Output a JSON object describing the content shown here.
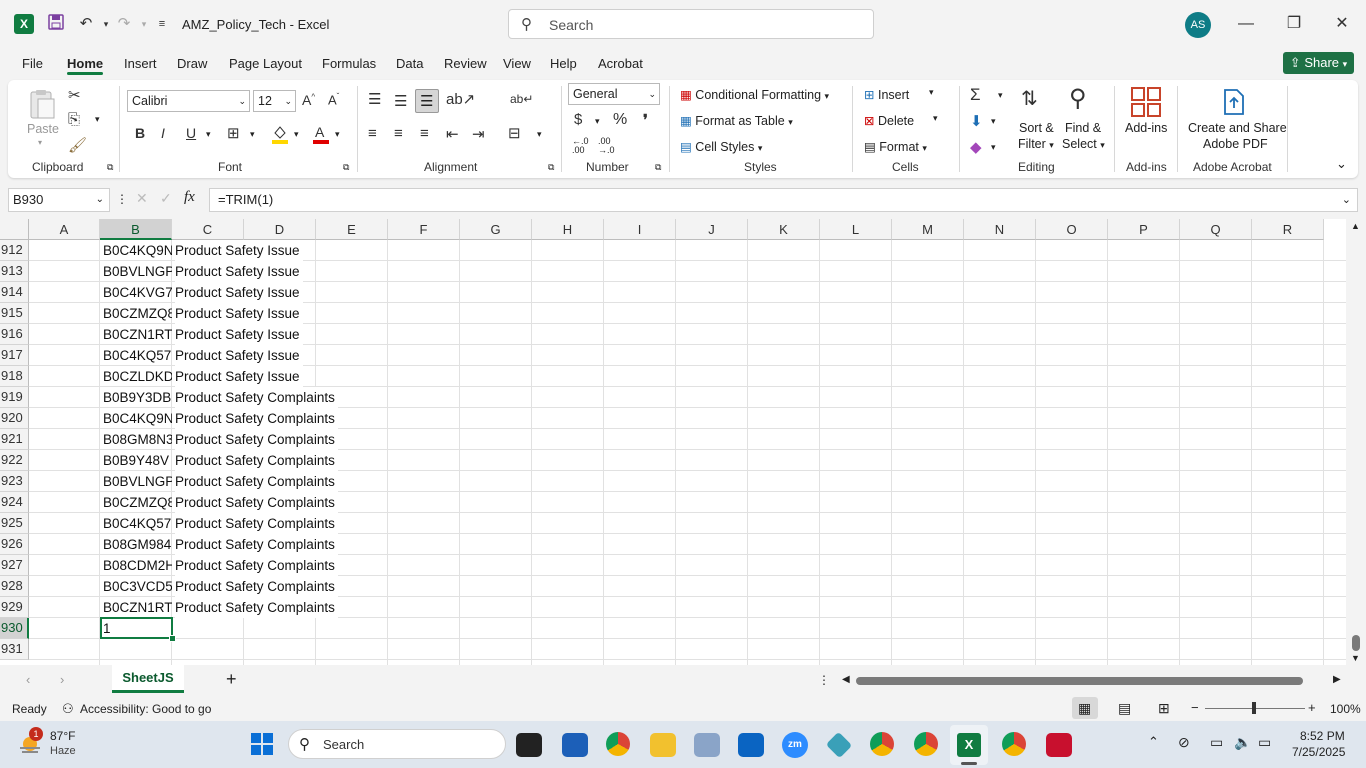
{
  "window": {
    "title": "AMZ_Policy_Tech  -  Excel",
    "app_logo": "X",
    "search_placeholder": "Search",
    "user_initials": "AS",
    "minimize": "—",
    "restore": "❐",
    "close": "✕"
  },
  "menu": {
    "tabs": [
      "File",
      "Home",
      "Insert",
      "Draw",
      "Page Layout",
      "Formulas",
      "Data",
      "Review",
      "View",
      "Help",
      "Acrobat"
    ],
    "active": "Home",
    "share_label": "Share"
  },
  "ribbon": {
    "clipboard": {
      "label": "Clipboard",
      "paste": "Paste"
    },
    "font": {
      "label": "Font",
      "family": "Calibri",
      "size": "12",
      "bold": "B",
      "italic": "I",
      "underline": "U"
    },
    "alignment": {
      "label": "Alignment"
    },
    "number": {
      "label": "Number",
      "format": "General"
    },
    "styles": {
      "label": "Styles",
      "conditional": "Conditional Formatting",
      "as_table": "Format as Table",
      "cell_styles": "Cell Styles"
    },
    "cells": {
      "label": "Cells",
      "insert": "Insert",
      "delete": "Delete",
      "format": "Format"
    },
    "editing": {
      "label": "Editing",
      "sort1": "Sort &",
      "sort2": "Filter",
      "find1": "Find &",
      "find2": "Select"
    },
    "addins": {
      "label": "Add-ins",
      "btn": "Add-ins"
    },
    "acrobat": {
      "label": "Adobe Acrobat",
      "btn1": "Create and Share",
      "btn2": "Adobe PDF"
    }
  },
  "formula_bar": {
    "name_box": "B930",
    "fx": "fx",
    "formula": "=TRIM(1)"
  },
  "grid": {
    "columns": [
      "A",
      "B",
      "C",
      "D",
      "E",
      "F",
      "G",
      "H",
      "I",
      "J",
      "K",
      "L",
      "M",
      "N",
      "O",
      "P",
      "Q",
      "R"
    ],
    "rows": [
      {
        "num": "912",
        "b": "B0C4KQ9N",
        "c": "Product Safety Issue"
      },
      {
        "num": "913",
        "b": "B0BVLNGP",
        "c": "Product Safety Issue"
      },
      {
        "num": "914",
        "b": "B0C4KVG7",
        "c": "Product Safety Issue"
      },
      {
        "num": "915",
        "b": "B0CZMZQ8",
        "c": "Product Safety Issue"
      },
      {
        "num": "916",
        "b": "B0CZN1RT",
        "c": "Product Safety Issue"
      },
      {
        "num": "917",
        "b": "B0C4KQ57",
        "c": "Product Safety Issue"
      },
      {
        "num": "918",
        "b": "B0CZLDKD",
        "c": "Product Safety Issue"
      },
      {
        "num": "919",
        "b": "B0B9Y3DB",
        "c": "Product Safety Complaints"
      },
      {
        "num": "920",
        "b": "B0C4KQ9N",
        "c": "Product Safety Complaints"
      },
      {
        "num": "921",
        "b": "B08GM8N3",
        "c": "Product Safety Complaints"
      },
      {
        "num": "922",
        "b": "B0B9Y48V",
        "c": "Product Safety Complaints"
      },
      {
        "num": "923",
        "b": "B0BVLNGP",
        "c": "Product Safety Complaints"
      },
      {
        "num": "924",
        "b": "B0CZMZQ8",
        "c": "Product Safety Complaints"
      },
      {
        "num": "925",
        "b": "B0C4KQ57",
        "c": "Product Safety Complaints"
      },
      {
        "num": "926",
        "b": "B08GM984",
        "c": "Product Safety Complaints"
      },
      {
        "num": "927",
        "b": "B08CDM2H",
        "c": "Product Safety Complaints"
      },
      {
        "num": "928",
        "b": "B0C3VCD5",
        "c": "Product Safety Complaints"
      },
      {
        "num": "929",
        "b": "B0CZN1RT",
        "c": "Product Safety Complaints"
      },
      {
        "num": "930",
        "b": "1",
        "c": ""
      },
      {
        "num": "931",
        "b": "",
        "c": ""
      }
    ]
  },
  "sheets": {
    "active": "SheetJS",
    "add": "+"
  },
  "status": {
    "ready": "Ready",
    "accessibility": "Accessibility: Good to go",
    "zoom": "100%"
  },
  "taskbar": {
    "weather_temp": "87°F",
    "weather_desc": "Haze",
    "weather_badge": "1",
    "search": "Search",
    "time": "8:52 PM",
    "date": "7/25/2025"
  },
  "colors": {
    "excel_green": "#107c41",
    "share_green": "#1e7145"
  }
}
